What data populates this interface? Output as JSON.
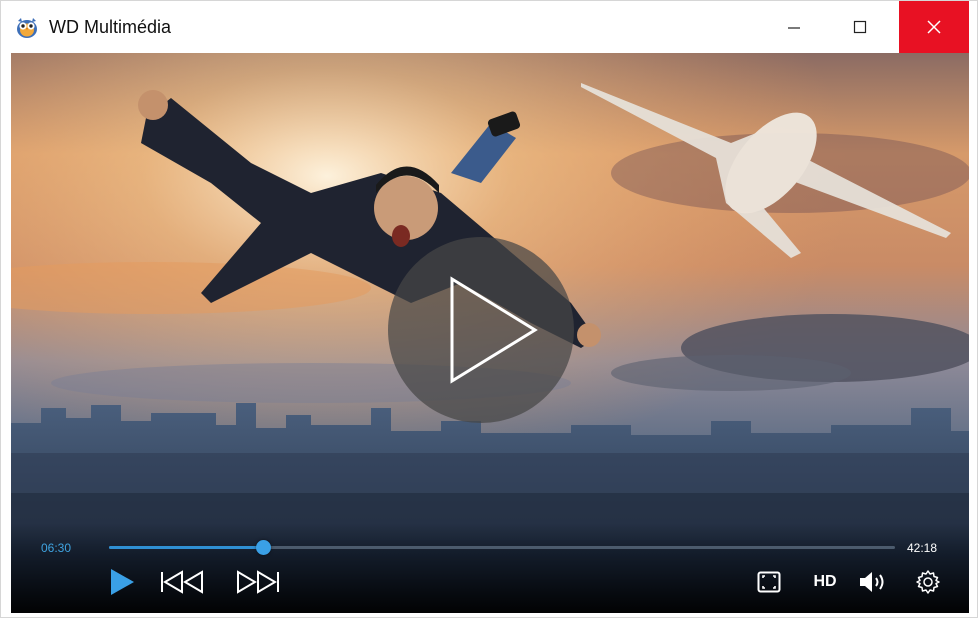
{
  "window": {
    "title": "WD Multimédia",
    "icon": "owl-app-icon",
    "close_color": "#e81123"
  },
  "player": {
    "current_time": "06:30",
    "total_time": "42:18",
    "progress": 0.196,
    "accent_color": "#3aa0e6",
    "quality_label": "HD",
    "icons": [
      "play-icon",
      "previous-icon",
      "next-icon",
      "fullscreen-icon",
      "volume-icon",
      "settings-icon"
    ]
  }
}
